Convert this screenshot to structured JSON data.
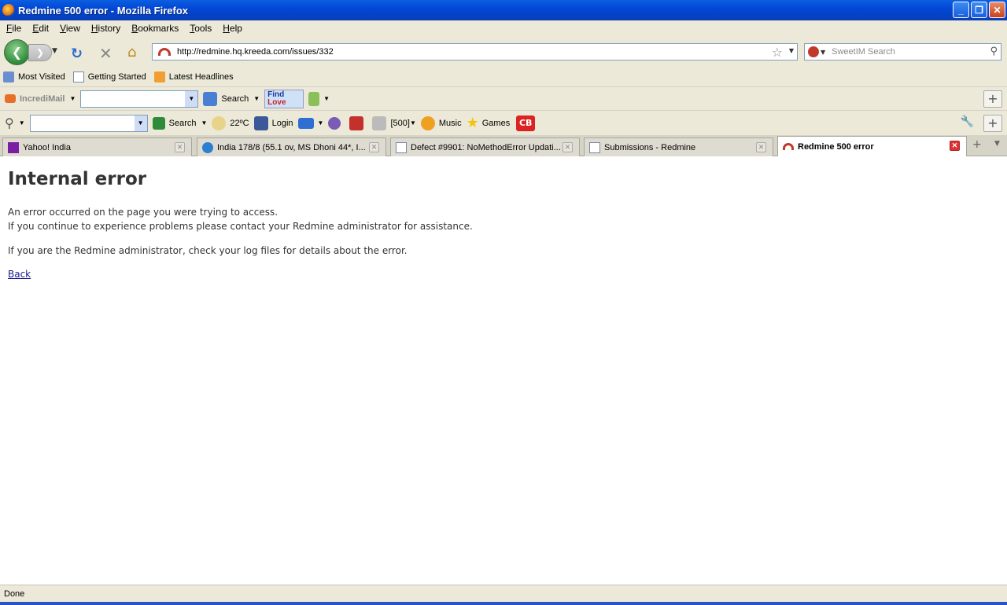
{
  "window": {
    "title": "Redmine 500 error - Mozilla Firefox"
  },
  "menu": [
    "File",
    "Edit",
    "View",
    "History",
    "Bookmarks",
    "Tools",
    "Help"
  ],
  "nav": {
    "url": "http://redmine.hq.kreeda.com/issues/332",
    "search_placeholder": "SweetIM Search"
  },
  "bookmarks": [
    "Most Visited",
    "Getting Started",
    "Latest Headlines"
  ],
  "toolbar1": {
    "brand": "IncrediMail",
    "search_label": "Search",
    "findlove_line1": "Find",
    "findlove_line2": "Love"
  },
  "toolbar2": {
    "search_label": "Search",
    "weather": "22ºC",
    "login": "Login",
    "count": "[500]",
    "music": "Music",
    "games": "Games",
    "cb": "CB"
  },
  "tabs": [
    {
      "label": "Yahoo! India",
      "icon": "yahoo-icon",
      "active": false
    },
    {
      "label": "India 178/8 (55.1 ov, MS Dhoni 44*, I...",
      "icon": "cricket-icon",
      "active": false
    },
    {
      "label": "Defect #9901: NoMethodError Updati...",
      "icon": "page-icon",
      "active": false
    },
    {
      "label": "Submissions - Redmine",
      "icon": "page-icon",
      "active": false
    },
    {
      "label": "Redmine 500 error",
      "icon": "redmine-icon",
      "active": true
    }
  ],
  "page": {
    "heading": "Internal error",
    "line1": "An error occurred on the page you were trying to access.",
    "line2": "If you continue to experience problems please contact your Redmine administrator for assistance.",
    "line3": "If you are the Redmine administrator, check your log files for details about the error.",
    "back_link": "Back"
  },
  "status": "Done"
}
